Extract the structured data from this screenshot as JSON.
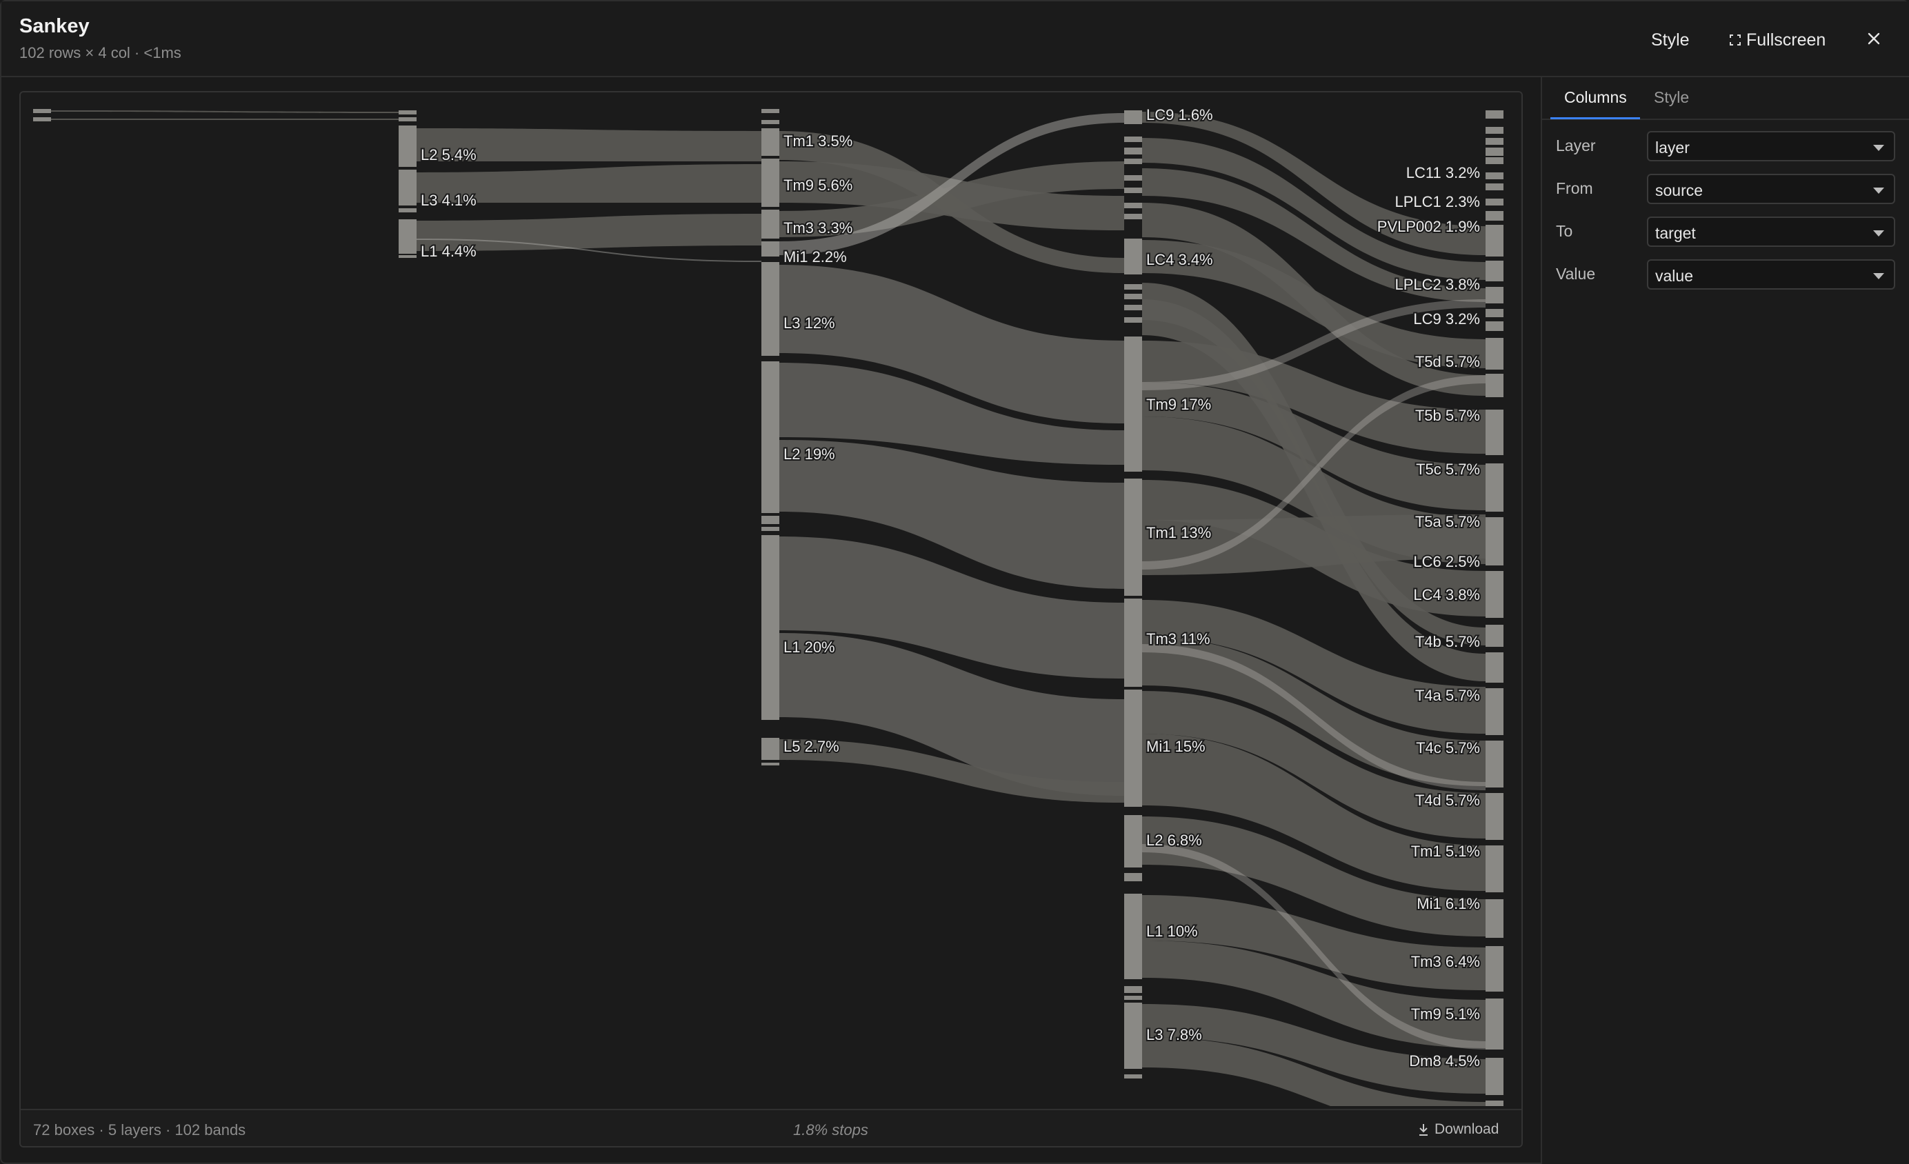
{
  "header": {
    "title": "Sankey",
    "subtitle": "102 rows × 4 col · <1ms",
    "style_label": "Style",
    "fullscreen_label": "Fullscreen",
    "close_label": "✕"
  },
  "footer": {
    "stats": "72 boxes · 5 layers · 102 bands",
    "stops": "1.8% stops",
    "download_label": "Download"
  },
  "panel": {
    "tabs": [
      {
        "label": "Columns",
        "active": true
      },
      {
        "label": "Style",
        "active": false
      }
    ],
    "fields": [
      {
        "label": "Layer",
        "value": "layer"
      },
      {
        "label": "From",
        "value": "source"
      },
      {
        "label": "To",
        "value": "target"
      },
      {
        "label": "Value",
        "value": "value"
      }
    ]
  },
  "colors": {
    "node": "#8a8985",
    "band": "#5c5b57",
    "band_highlight": "#bfbdb8",
    "accent": "#3b82f6"
  },
  "chart_data": {
    "type": "sankey",
    "layers": 5,
    "node_labels": [
      {
        "layer": 2,
        "labels": [
          "L2 5.4%",
          "L3 4.1%",
          "L1 4.4%"
        ]
      },
      {
        "layer": 3,
        "labels": [
          "Tm1 3.5%",
          "Tm9 5.6%",
          "Tm3 3.3%",
          "Mi1 2.2%",
          "L3 12%",
          "L2 19%",
          "L1 20%",
          "L5 2.7%"
        ]
      },
      {
        "layer": 4,
        "labels": [
          "LC9 1.6%",
          "LC4 3.4%",
          "Tm9 17%",
          "Tm1 13%",
          "Tm3 11%",
          "Mi1 15%",
          "L2 6.8%",
          "L1 10%",
          "L3 7.8%"
        ]
      },
      {
        "layer": 5,
        "labels": [
          "LC11 3.2%",
          "LPLC1 2.3%",
          "PVLP002 1.9%",
          "LPLC2 3.8%",
          "LC9 3.2%",
          "T5d 5.7%",
          "T5b 5.7%",
          "T5c 5.7%",
          "T5a 5.7%",
          "LC6 2.5%",
          "LC4 3.8%",
          "T4b 5.7%",
          "T4a 5.7%",
          "T4c 5.7%",
          "T4d 5.7%",
          "Tm1 5.1%",
          "Mi1 6.1%",
          "Tm3 6.4%",
          "Tm9 5.1%",
          "Dm8 4.5%"
        ]
      }
    ]
  }
}
